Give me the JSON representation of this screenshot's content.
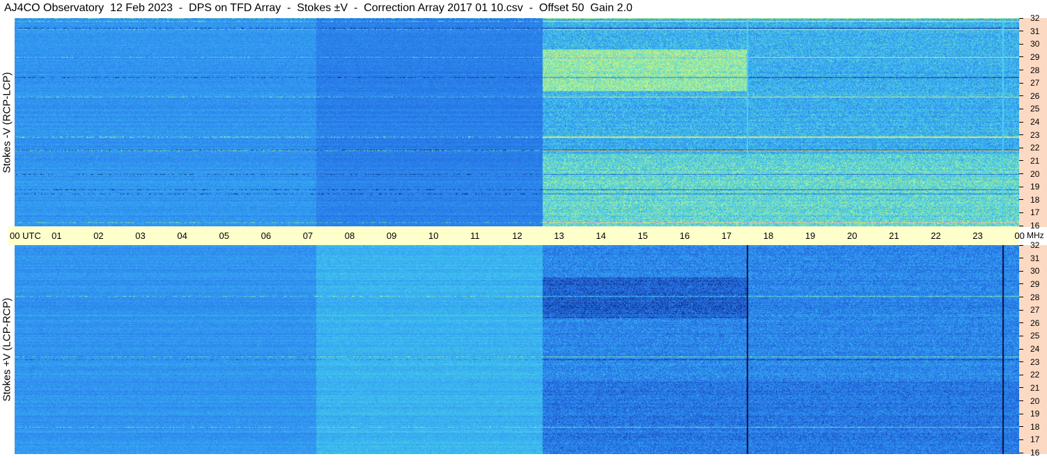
{
  "title": "AJ4CO Observatory  12 Feb 2023  -  DPS on TFD Array  -  Stokes ±V  -  Correction Array 2017 01 10.csv  -  Offset 50  Gain 2.0",
  "chart_data": [
    {
      "type": "heatmap",
      "ylabel": "Stokes -V (RCP-LCP)",
      "x_ticks": [
        "00  UTC",
        "01",
        "02",
        "03",
        "04",
        "05",
        "06",
        "07",
        "08",
        "09",
        "10",
        "11",
        "12",
        "13",
        "14",
        "15",
        "16",
        "17",
        "18",
        "19",
        "20",
        "21",
        "22",
        "23",
        "00"
      ],
      "y_ticks": [
        "16",
        "17",
        "18",
        "19",
        "20",
        "21",
        "22",
        "23",
        "24",
        "25",
        "26",
        "27",
        "28",
        "29",
        "30",
        "31",
        "32"
      ],
      "y_range": [
        16,
        32
      ],
      "x_range_hours": [
        0,
        24
      ],
      "colormap": [
        "#0a1a60",
        "#1e5fd8",
        "#2f8cf0",
        "#3ec4f0",
        "#9cf0a0",
        "#f0f060",
        "#f080f0"
      ]
    },
    {
      "type": "heatmap",
      "ylabel": "Stokes +V (LCP-RCP)",
      "x_ticks": [
        "00  UTC",
        "01",
        "02",
        "03",
        "04",
        "05",
        "06",
        "07",
        "08",
        "09",
        "10",
        "11",
        "12",
        "13",
        "14",
        "15",
        "16",
        "17",
        "18",
        "19",
        "20",
        "21",
        "22",
        "23",
        "00"
      ],
      "y_ticks": [
        "16",
        "17",
        "18",
        "19",
        "20",
        "21",
        "22",
        "23",
        "24",
        "25",
        "26",
        "27",
        "28",
        "29",
        "30",
        "31",
        "32"
      ],
      "y_range": [
        16,
        32
      ],
      "x_range_hours": [
        0,
        24
      ],
      "colormap": [
        "#0a1a60",
        "#1e5fd8",
        "#2f8cf0",
        "#3ec4f0",
        "#9cf0a0",
        "#f0f060",
        "#f080f0"
      ]
    }
  ],
  "freq_unit": "MHz"
}
